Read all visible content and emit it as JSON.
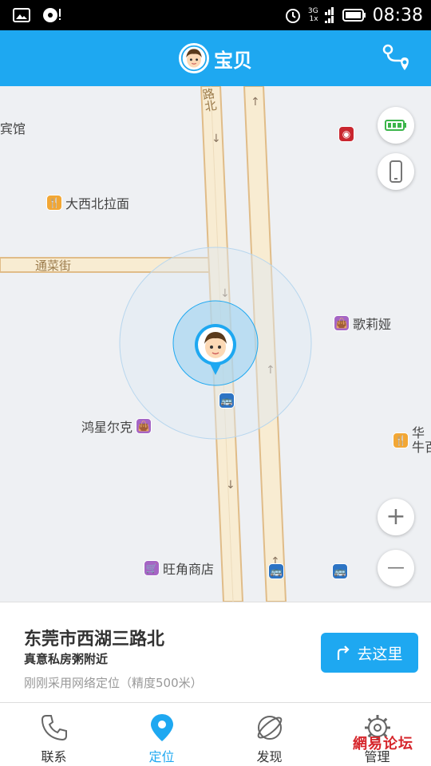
{
  "status_bar": {
    "net_top": "3G",
    "net_bottom": "1x",
    "time": "08:38"
  },
  "app_bar": {
    "title": "宝贝"
  },
  "map": {
    "road_north": "路北",
    "road_tongcai": "通菜街",
    "pois": {
      "hotel_partial": "宾馆",
      "daxibei": "大西北拉面",
      "geliya": "歌莉娅",
      "hongxing": "鸿星尔克",
      "huaji_line1": "华",
      "huaji_line2": "牛百",
      "wangjiao": "旺角商店"
    },
    "zoom_in": "+",
    "zoom_out": "—"
  },
  "location_card": {
    "address": "东莞市西湖三路北",
    "nearby": "真意私房粥附近",
    "accuracy": "刚刚采用网络定位（精度500米）",
    "go_button": "去这里"
  },
  "bottom_nav": {
    "items": [
      {
        "label": "联系",
        "icon": "phone-icon",
        "active": false
      },
      {
        "label": "定位",
        "icon": "location-pin-icon",
        "active": true
      },
      {
        "label": "发现",
        "icon": "planet-icon",
        "active": false
      },
      {
        "label": "管理",
        "icon": "gear-icon",
        "active": false
      }
    ]
  },
  "watermark": "網易论坛",
  "colors": {
    "primary": "#1ea8f1",
    "map_bg": "#eef0f3",
    "road_fill": "#f8ecd2",
    "road_border": "#e0bc88"
  }
}
